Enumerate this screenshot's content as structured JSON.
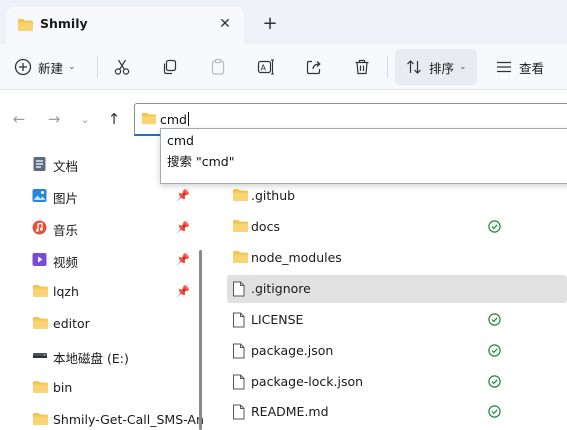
{
  "window": {
    "tab_title": "Shmily",
    "new_tab_label": "+",
    "close_label": "✕"
  },
  "toolbar": {
    "new_label": "新建",
    "sort_label": "排序",
    "view_label": "查看"
  },
  "address": {
    "value": "cmd"
  },
  "suggestions": [
    {
      "label": "cmd"
    },
    {
      "label": "搜索 \"cmd\""
    }
  ],
  "sidebar": {
    "items": [
      {
        "label": "文档",
        "icon": "documents-icon",
        "pinned": false
      },
      {
        "label": "图片",
        "icon": "pictures-icon",
        "pinned": true
      },
      {
        "label": "音乐",
        "icon": "music-icon",
        "pinned": true
      },
      {
        "label": "视频",
        "icon": "videos-icon",
        "pinned": true
      },
      {
        "label": "lqzh",
        "icon": "folder-icon",
        "pinned": true
      },
      {
        "label": "editor",
        "icon": "folder-icon",
        "pinned": false
      },
      {
        "label": "本地磁盘 (E:)",
        "icon": "drive-icon",
        "pinned": false
      },
      {
        "label": "bin",
        "icon": "folder-icon",
        "pinned": false
      },
      {
        "label": "Shmily-Get-Call_SMS-An",
        "icon": "folder-icon",
        "pinned": false
      }
    ]
  },
  "files": [
    {
      "name": ".github",
      "icon": "folder-icon",
      "synced": false,
      "selected": false
    },
    {
      "name": "docs",
      "icon": "folder-icon",
      "synced": true,
      "selected": false
    },
    {
      "name": "node_modules",
      "icon": "folder-icon",
      "synced": false,
      "selected": false
    },
    {
      "name": ".gitignore",
      "icon": "file-icon",
      "synced": false,
      "selected": true
    },
    {
      "name": "LICENSE",
      "icon": "file-icon",
      "synced": true,
      "selected": false
    },
    {
      "name": "package.json",
      "icon": "file-icon",
      "synced": true,
      "selected": false
    },
    {
      "name": "package-lock.json",
      "icon": "file-icon",
      "synced": true,
      "selected": false
    },
    {
      "name": "README.md",
      "icon": "file-icon",
      "synced": true,
      "selected": false
    }
  ],
  "colors": {
    "folder": "#f4c54a",
    "accent": "#1a6fd6",
    "synced": "#1e8a3a"
  }
}
